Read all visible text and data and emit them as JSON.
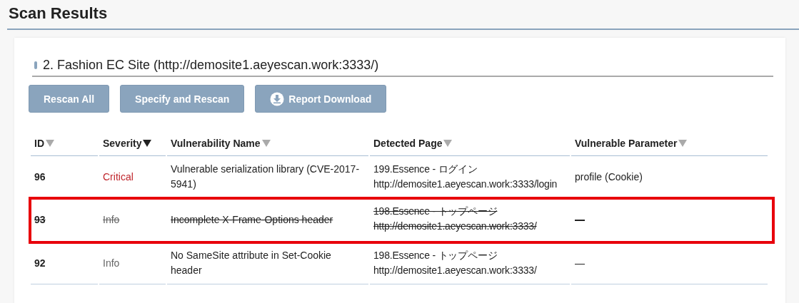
{
  "page_title": "Scan Results",
  "section": {
    "title": "2. Fashion EC Site (http://demosite1.aeyescan.work:3333/)"
  },
  "buttons": [
    {
      "label": "Rescan All",
      "kind": "plain"
    },
    {
      "label": "Specify and Rescan",
      "kind": "plain"
    },
    {
      "label": "Report Download",
      "kind": "download"
    }
  ],
  "table": {
    "columns": [
      {
        "label": "ID",
        "selected": false
      },
      {
        "label": "Severity",
        "selected": true
      },
      {
        "label": "Vulnerability Name",
        "selected": false
      },
      {
        "label": "Detected Page",
        "selected": false
      },
      {
        "label": "Vulnerable Parameter",
        "selected": false
      }
    ],
    "rows": [
      {
        "id": "96",
        "severity": "Critical",
        "color": "#c0262d",
        "name": "Vulnerable serialization library (CVE-2017-5941)",
        "page_title": "199.Essence - ログイン",
        "page_url": "http://demosite1.aeyescan.work:3333/login",
        "parameter": "profile (Cookie)",
        "struck": false,
        "highlighted": false
      },
      {
        "id": "93",
        "severity": "Info",
        "color": "#666666",
        "name": "Incomplete X-Frame-Options header",
        "page_title": "198.Essence - トップページ",
        "page_url": "http://demosite1.aeyescan.work:3333/",
        "parameter": "—",
        "struck": true,
        "highlighted": true
      },
      {
        "id": "92",
        "severity": "Info",
        "color": "#666666",
        "name": "No SameSite attribute in Set-Cookie header",
        "page_title": "198.Essence - トップページ",
        "page_url": "http://demosite1.aeyescan.work:3333/",
        "parameter": "—",
        "struck": false,
        "highlighted": false
      }
    ]
  }
}
